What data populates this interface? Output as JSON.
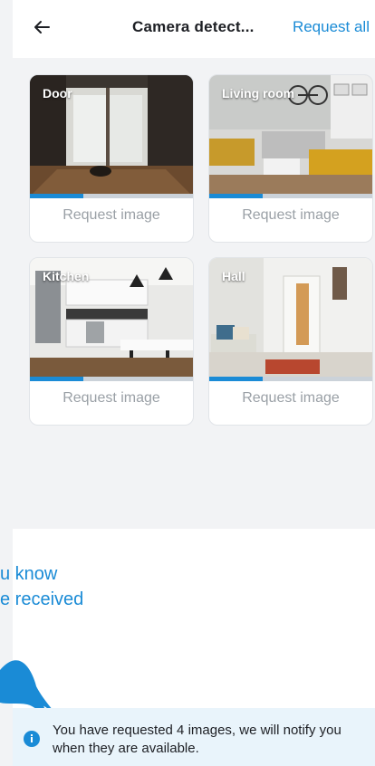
{
  "header": {
    "title": "Camera detect...",
    "request_all": "Request all"
  },
  "cameras": [
    {
      "name": "Door",
      "action": "Request image",
      "progress": 0.33
    },
    {
      "name": "Living room",
      "action": "Request image",
      "progress": 0.33
    },
    {
      "name": "Kitchen",
      "action": "Request image",
      "progress": 0.33
    },
    {
      "name": "Hall",
      "action": "Request image",
      "progress": 0.33
    }
  ],
  "hint": {
    "line1": "u know",
    "line2": "e received"
  },
  "notice": {
    "text": "You have requested 4 images, we will notify you when they are available."
  },
  "colors": {
    "accent": "#1a8bd6",
    "background": "#f2f3f5",
    "notice_bg": "#e9f4fb"
  },
  "icons": {
    "back": "arrow-left-icon",
    "info": "info-icon",
    "hand": "pointing-hand-icon"
  }
}
